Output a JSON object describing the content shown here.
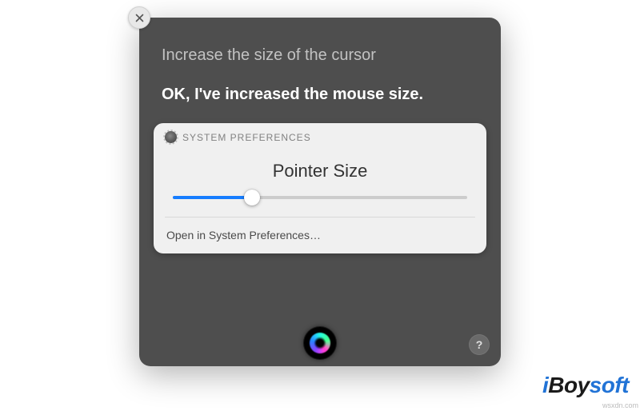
{
  "siri": {
    "query": "Increase the size of the cursor",
    "response": "OK, I've increased the mouse size.",
    "card": {
      "app_label": "SYSTEM PREFERENCES",
      "title": "Pointer Size",
      "slider_percent": 27,
      "open_link": "Open in System Preferences…"
    },
    "help_glyph": "?"
  },
  "watermark": {
    "seg1": "i",
    "seg2": "Boy",
    "seg3": "soft"
  },
  "attribution": "wsxdn.com"
}
